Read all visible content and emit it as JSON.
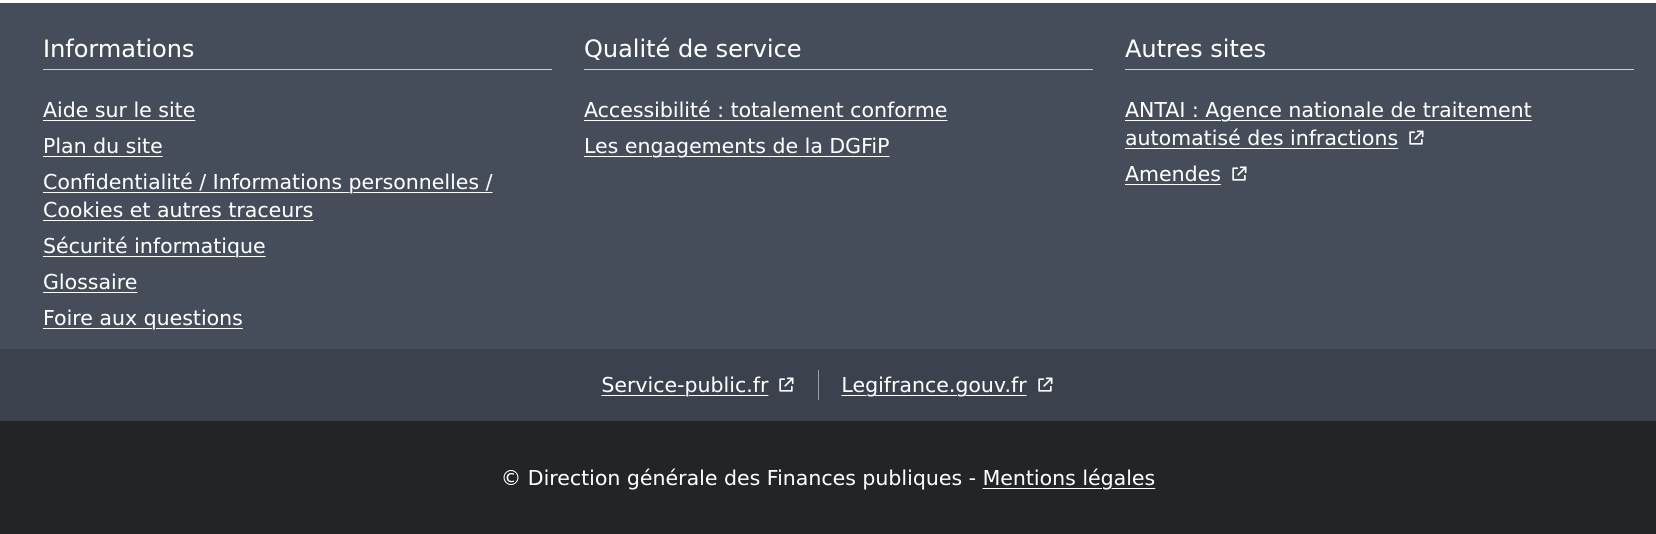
{
  "colors": {
    "main_bg": "#454d5a",
    "partners_bg": "#3b424d",
    "bottom_bg": "#232425",
    "text": "#ffffff"
  },
  "columns": [
    {
      "title": "Informations",
      "links": [
        {
          "label": "Aide sur le site"
        },
        {
          "label": "Plan du site"
        },
        {
          "label": "Confidentialité / Informations personnelles / Cookies et autres traceurs"
        },
        {
          "label": "Sécurité informatique"
        },
        {
          "label": "Glossaire"
        },
        {
          "label": "Foire aux questions"
        }
      ]
    },
    {
      "title": "Qualité de service",
      "links": [
        {
          "label": "Accessibilité : totalement conforme"
        },
        {
          "label": "Les engagements de la DGFiP"
        }
      ]
    },
    {
      "title": "Autres sites",
      "links": [
        {
          "label": "ANTAI : Agence nationale de traitement automatisé des infractions",
          "icon": "external-link-icon"
        },
        {
          "label": "Amendes",
          "icon": "external-link-icon"
        }
      ]
    }
  ],
  "partners": [
    {
      "label": "Service-public.fr",
      "icon": "external-link-icon"
    },
    {
      "label": "Legifrance.gouv.fr",
      "icon": "external-link-icon"
    }
  ],
  "bottom": {
    "copyright": "© Direction générale des Finances publiques - ",
    "legal_link": "Mentions légales"
  }
}
